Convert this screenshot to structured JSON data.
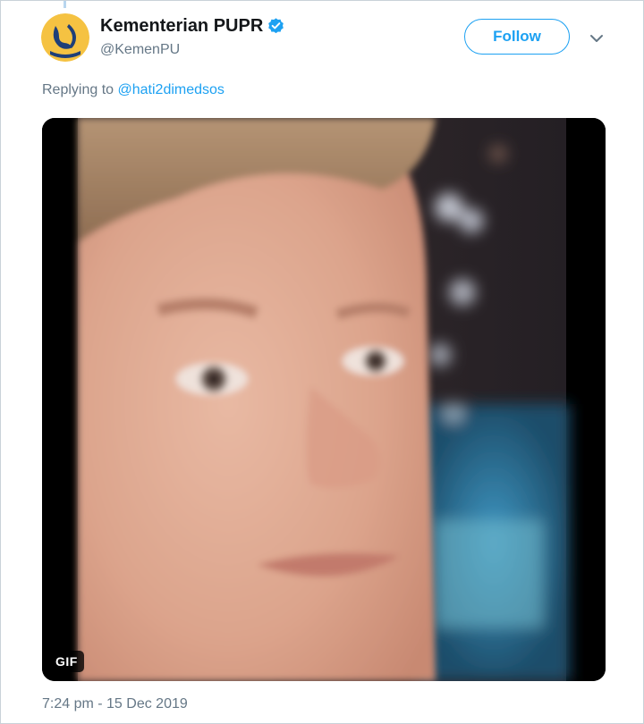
{
  "account": {
    "display_name": "Kementerian PUPR",
    "handle": "@KemenPU",
    "verified": true,
    "avatar_icon": "kemenpu-logo-avatar",
    "brand_color": "#f5c242"
  },
  "actions": {
    "follow_label": "Follow",
    "more_icon": "chevron-down-icon"
  },
  "reply": {
    "prefix": "Replying to",
    "mention": "@hati2dimedsos"
  },
  "media": {
    "type": "gif",
    "badge_label": "GIF"
  },
  "tweet": {
    "timestamp": "7:24 pm - 15 Dec 2019"
  },
  "colors": {
    "accent": "#1da1f2",
    "secondary_text": "#657786",
    "primary_text": "#14171a"
  }
}
